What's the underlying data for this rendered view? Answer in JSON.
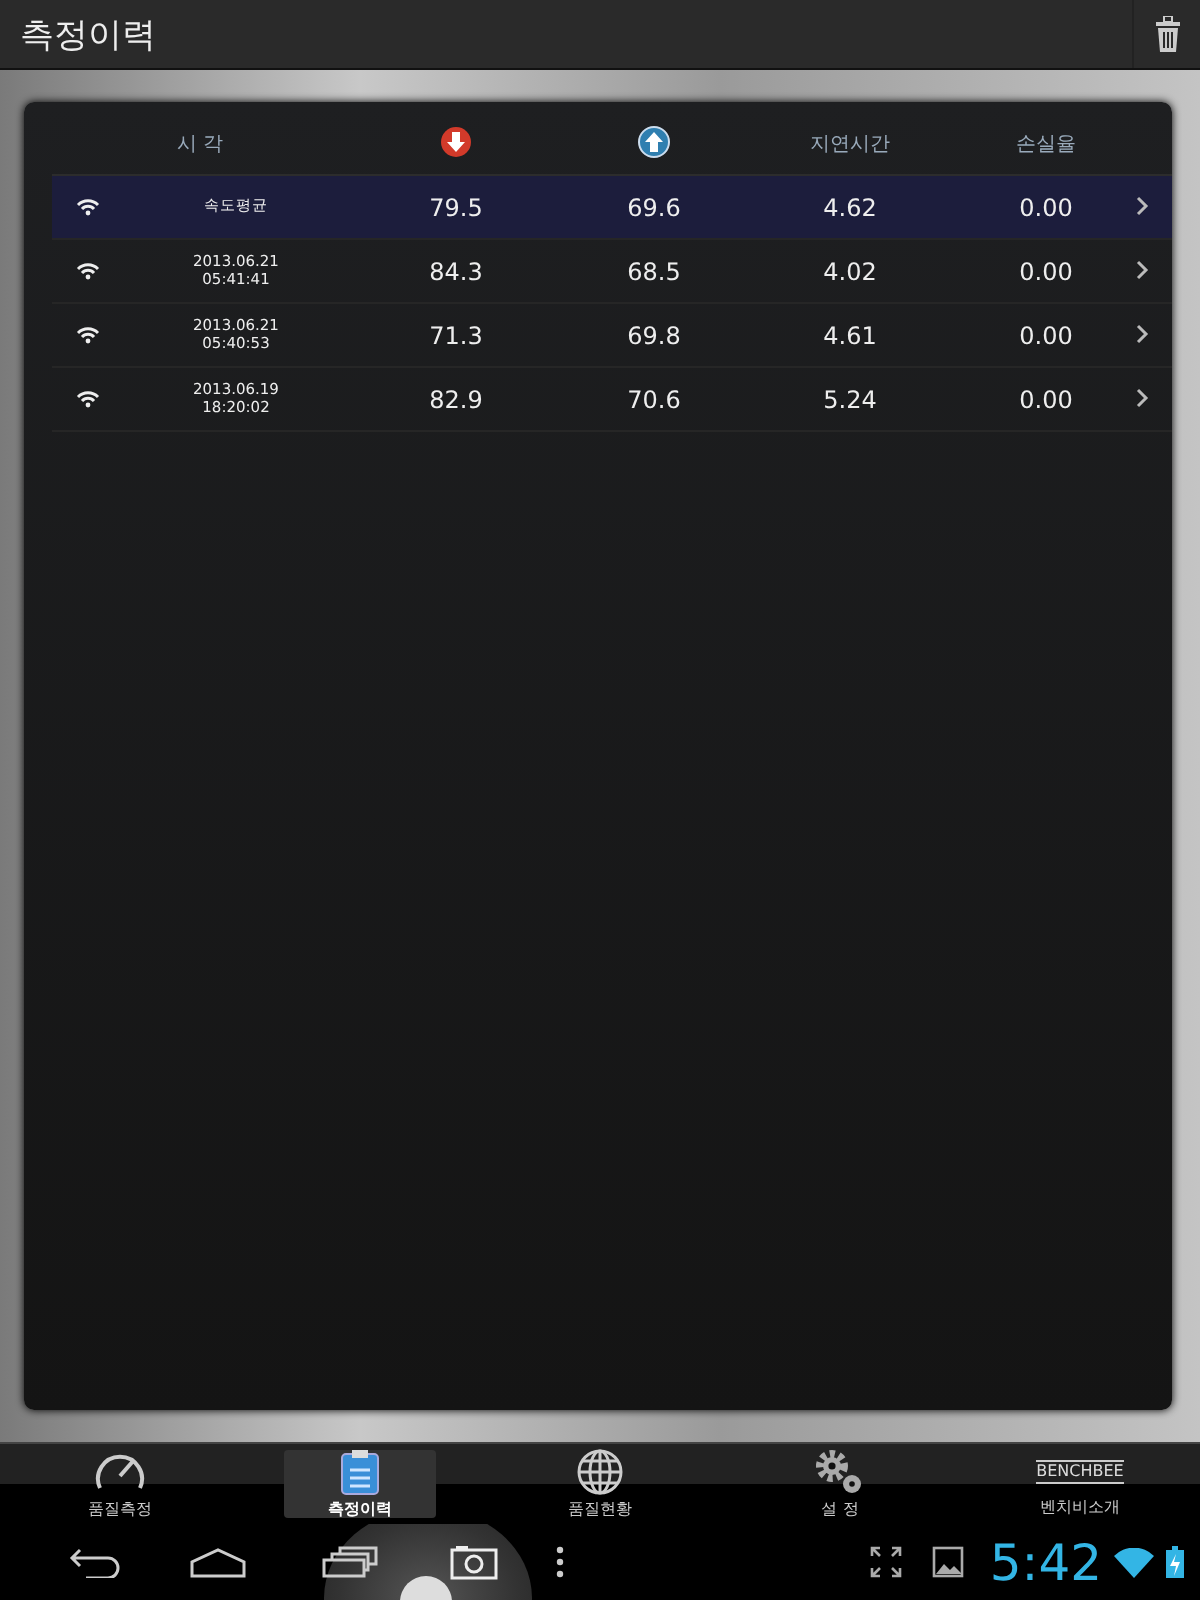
{
  "title": "측정이력",
  "table": {
    "columns": [
      {
        "kind": "text",
        "label": "시 각"
      },
      {
        "kind": "download"
      },
      {
        "kind": "upload"
      },
      {
        "kind": "text",
        "label": "지연시간"
      },
      {
        "kind": "text",
        "label": "손실율"
      }
    ],
    "rows": [
      {
        "selected": true,
        "time": "속도평균",
        "download": "79.5",
        "upload": "69.6",
        "latency": "4.62",
        "loss": "0.00"
      },
      {
        "selected": false,
        "time": "2013.06.21\n05:41:41",
        "download": "84.3",
        "upload": "68.5",
        "latency": "4.02",
        "loss": "0.00"
      },
      {
        "selected": false,
        "time": "2013.06.21\n05:40:53",
        "download": "71.3",
        "upload": "69.8",
        "latency": "4.61",
        "loss": "0.00"
      },
      {
        "selected": false,
        "time": "2013.06.19\n18:20:02",
        "download": "82.9",
        "upload": "70.6",
        "latency": "5.24",
        "loss": "0.00"
      }
    ]
  },
  "tabs": [
    {
      "kind": "gauge",
      "label": "품질측정",
      "selected": false
    },
    {
      "kind": "clipboard",
      "label": "측정이력",
      "selected": true
    },
    {
      "kind": "globe",
      "label": "품질현황",
      "selected": false
    },
    {
      "kind": "gears",
      "label": "설 정",
      "selected": false
    },
    {
      "kind": "logo",
      "logo_text": "BENCHBEE",
      "label": "벤치비소개",
      "selected": false
    }
  ],
  "status": {
    "clock": "5:42"
  }
}
